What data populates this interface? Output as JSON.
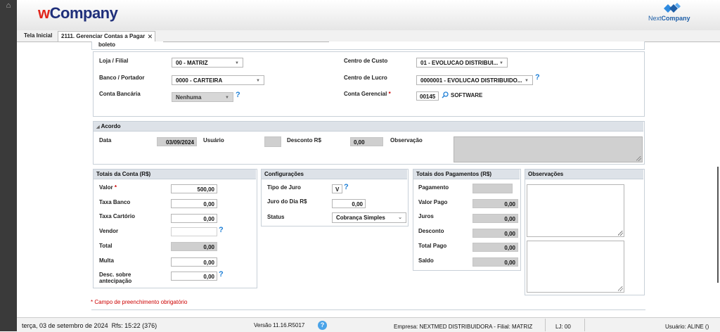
{
  "header": {
    "logo_w": "w",
    "logo_company": "Company",
    "brand_next": "Next",
    "brand_company": "Company"
  },
  "tabs": [
    {
      "label": "Tela Inicial"
    },
    {
      "label": "2111. Gerenciar Contas a Pagar"
    }
  ],
  "top_partial": {
    "label": "boleto"
  },
  "form": {
    "loja_label": "Loja / Filial",
    "loja_value": "00 - MATRIZ",
    "banco_label": "Banco / Portador",
    "banco_value": "0000 - CARTEIRA",
    "conta_bancaria_label": "Conta Bancária",
    "conta_bancaria_value": "Nenhuma",
    "centro_custo_label": "Centro de Custo",
    "centro_custo_value": "01 - EVOLUCAO DISTRIBUI...",
    "centro_lucro_label": "Centro de Lucro",
    "centro_lucro_value": "0000001 - EVOLUCAO DISTRIBUIDO...",
    "conta_gerencial_label": "Conta Gerencial",
    "conta_gerencial_code": "00145",
    "conta_gerencial_name": "SOFTWARE"
  },
  "acordo": {
    "title": "Acordo",
    "data_label": "Data",
    "data_value": "03/09/2024",
    "usuario_label": "Usuário",
    "usuario_value": "",
    "desconto_label": "Desconto R$",
    "desconto_value": "0,00",
    "observacao_label": "Observação"
  },
  "totais": {
    "title": "Totais da Conta (R$)",
    "rows": [
      {
        "label": "Valor",
        "value": "500,00",
        "required": true
      },
      {
        "label": "Taxa Banco",
        "value": "0,00"
      },
      {
        "label": "Taxa Cartório",
        "value": "0,00"
      },
      {
        "label": "Vendor",
        "value": ""
      },
      {
        "label": "Total",
        "value": "0,00"
      },
      {
        "label": "Multa",
        "value": "0,00"
      },
      {
        "label": "Desc. sobre antecipação",
        "value": "0,00"
      }
    ]
  },
  "config": {
    "title": "Configurações",
    "tipo_juro_label": "Tipo de Juro",
    "tipo_juro_value": "V",
    "juro_dia_label": "Juro do Dia R$",
    "juro_dia_value": "0,00",
    "status_label": "Status",
    "status_value": "Cobrança Simples"
  },
  "pagamentos": {
    "title": "Totais dos Pagamentos (R$)",
    "rows": [
      {
        "label": "Pagamento",
        "value": ""
      },
      {
        "label": "Valor Pago",
        "value": "0,00"
      },
      {
        "label": "Juros",
        "value": "0,00"
      },
      {
        "label": "Desconto",
        "value": "0,00"
      },
      {
        "label": "Total Pago",
        "value": "0,00"
      },
      {
        "label": "Saldo",
        "value": "0,00"
      }
    ]
  },
  "observacoes": {
    "title": "Observações"
  },
  "required_note": "Campo de preenchimento obrigatório",
  "required_mark": "*",
  "status": {
    "date": "terça, 03 de setembro de 2024",
    "rfs": "Rfs: 15:22 (376)",
    "versao": "Versão 11.16.R5017",
    "empresa": "Empresa: NEXTMED DISTRIBUIDORA - Filial: MATRIZ",
    "lj": "LJ: 00",
    "usuario": "Usuário: ALINE ()"
  },
  "colors": {
    "accent": "#1e7fd6",
    "required": "#cc0000",
    "logo_red": "#e1251b",
    "logo_blue": "#1f2f7a"
  }
}
